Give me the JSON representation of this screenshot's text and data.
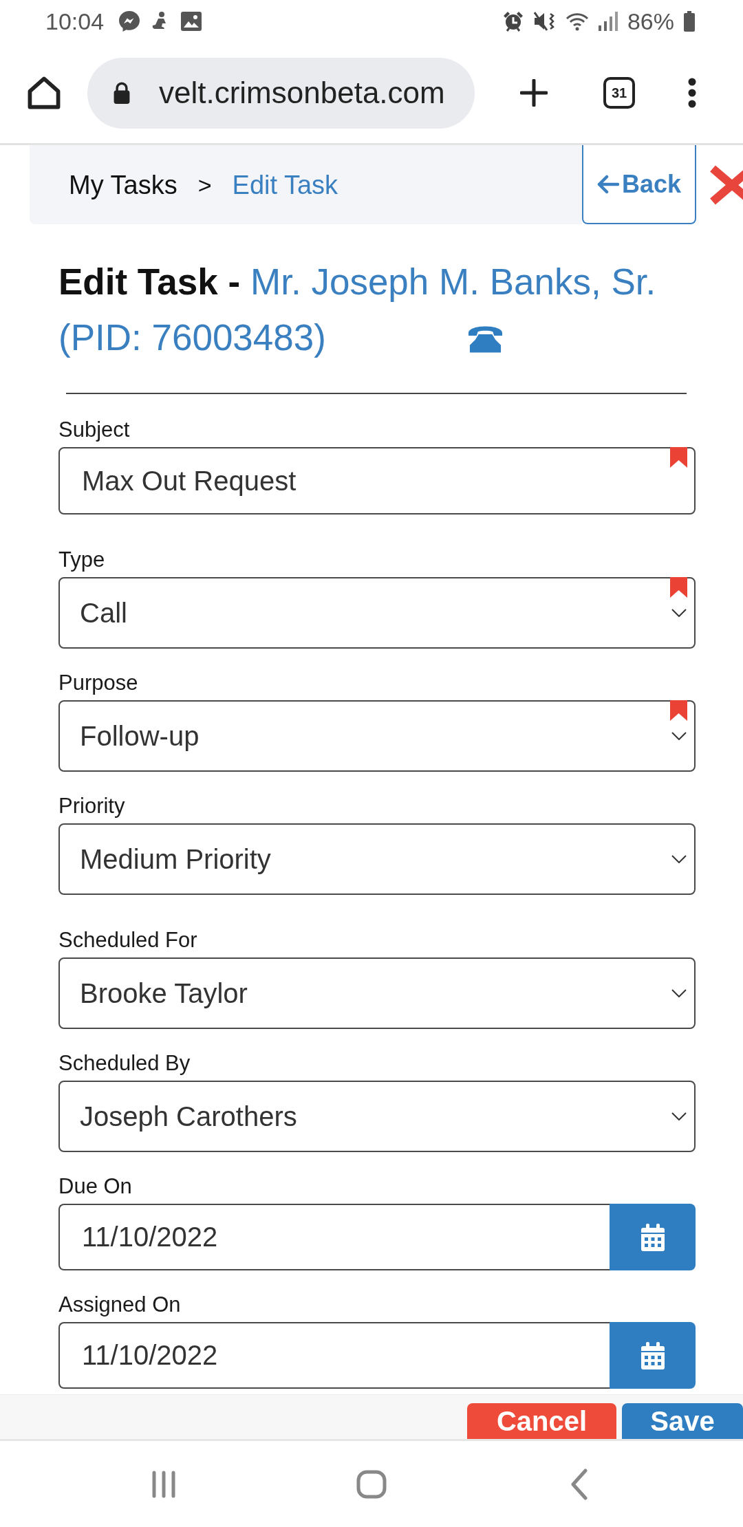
{
  "status_bar": {
    "time": "10:04",
    "battery": "86%"
  },
  "browser": {
    "url": "velt.crimsonbeta.com",
    "tab_count": "31"
  },
  "breadcrumb": {
    "items": [
      {
        "label": "My Tasks",
        "active": false
      },
      {
        "label": "Edit Task",
        "active": true
      }
    ],
    "separator": ">"
  },
  "back_button": {
    "label": "Back"
  },
  "heading": {
    "title": "Edit Task -",
    "patient_name": "Mr. Joseph M. Banks, Sr.",
    "patient_id": "(PID: 76003483)"
  },
  "form": {
    "fields": [
      {
        "kind": "text",
        "label": "Subject",
        "value": "Max Out Request",
        "required": true
      },
      {
        "kind": "select",
        "label": "Type",
        "value": "Call",
        "required": true
      },
      {
        "kind": "select",
        "label": "Purpose",
        "value": "Follow-up",
        "required": true
      },
      {
        "kind": "select",
        "label": "Priority",
        "value": "Medium Priority",
        "required": false
      },
      {
        "kind": "select",
        "label": "Scheduled For",
        "value": "Brooke Taylor",
        "required": false
      },
      {
        "kind": "select",
        "label": "Scheduled By",
        "value": "Joseph Carothers",
        "required": false
      },
      {
        "kind": "date",
        "label": "Due On",
        "value": "11/10/2022",
        "required": false
      },
      {
        "kind": "date",
        "label": "Assigned On",
        "value": "11/10/2022",
        "required": false
      }
    ]
  },
  "footer": {
    "buttons": [
      {
        "label": "Cancel",
        "kind": "danger"
      },
      {
        "label": "Save",
        "kind": "primary"
      }
    ]
  }
}
